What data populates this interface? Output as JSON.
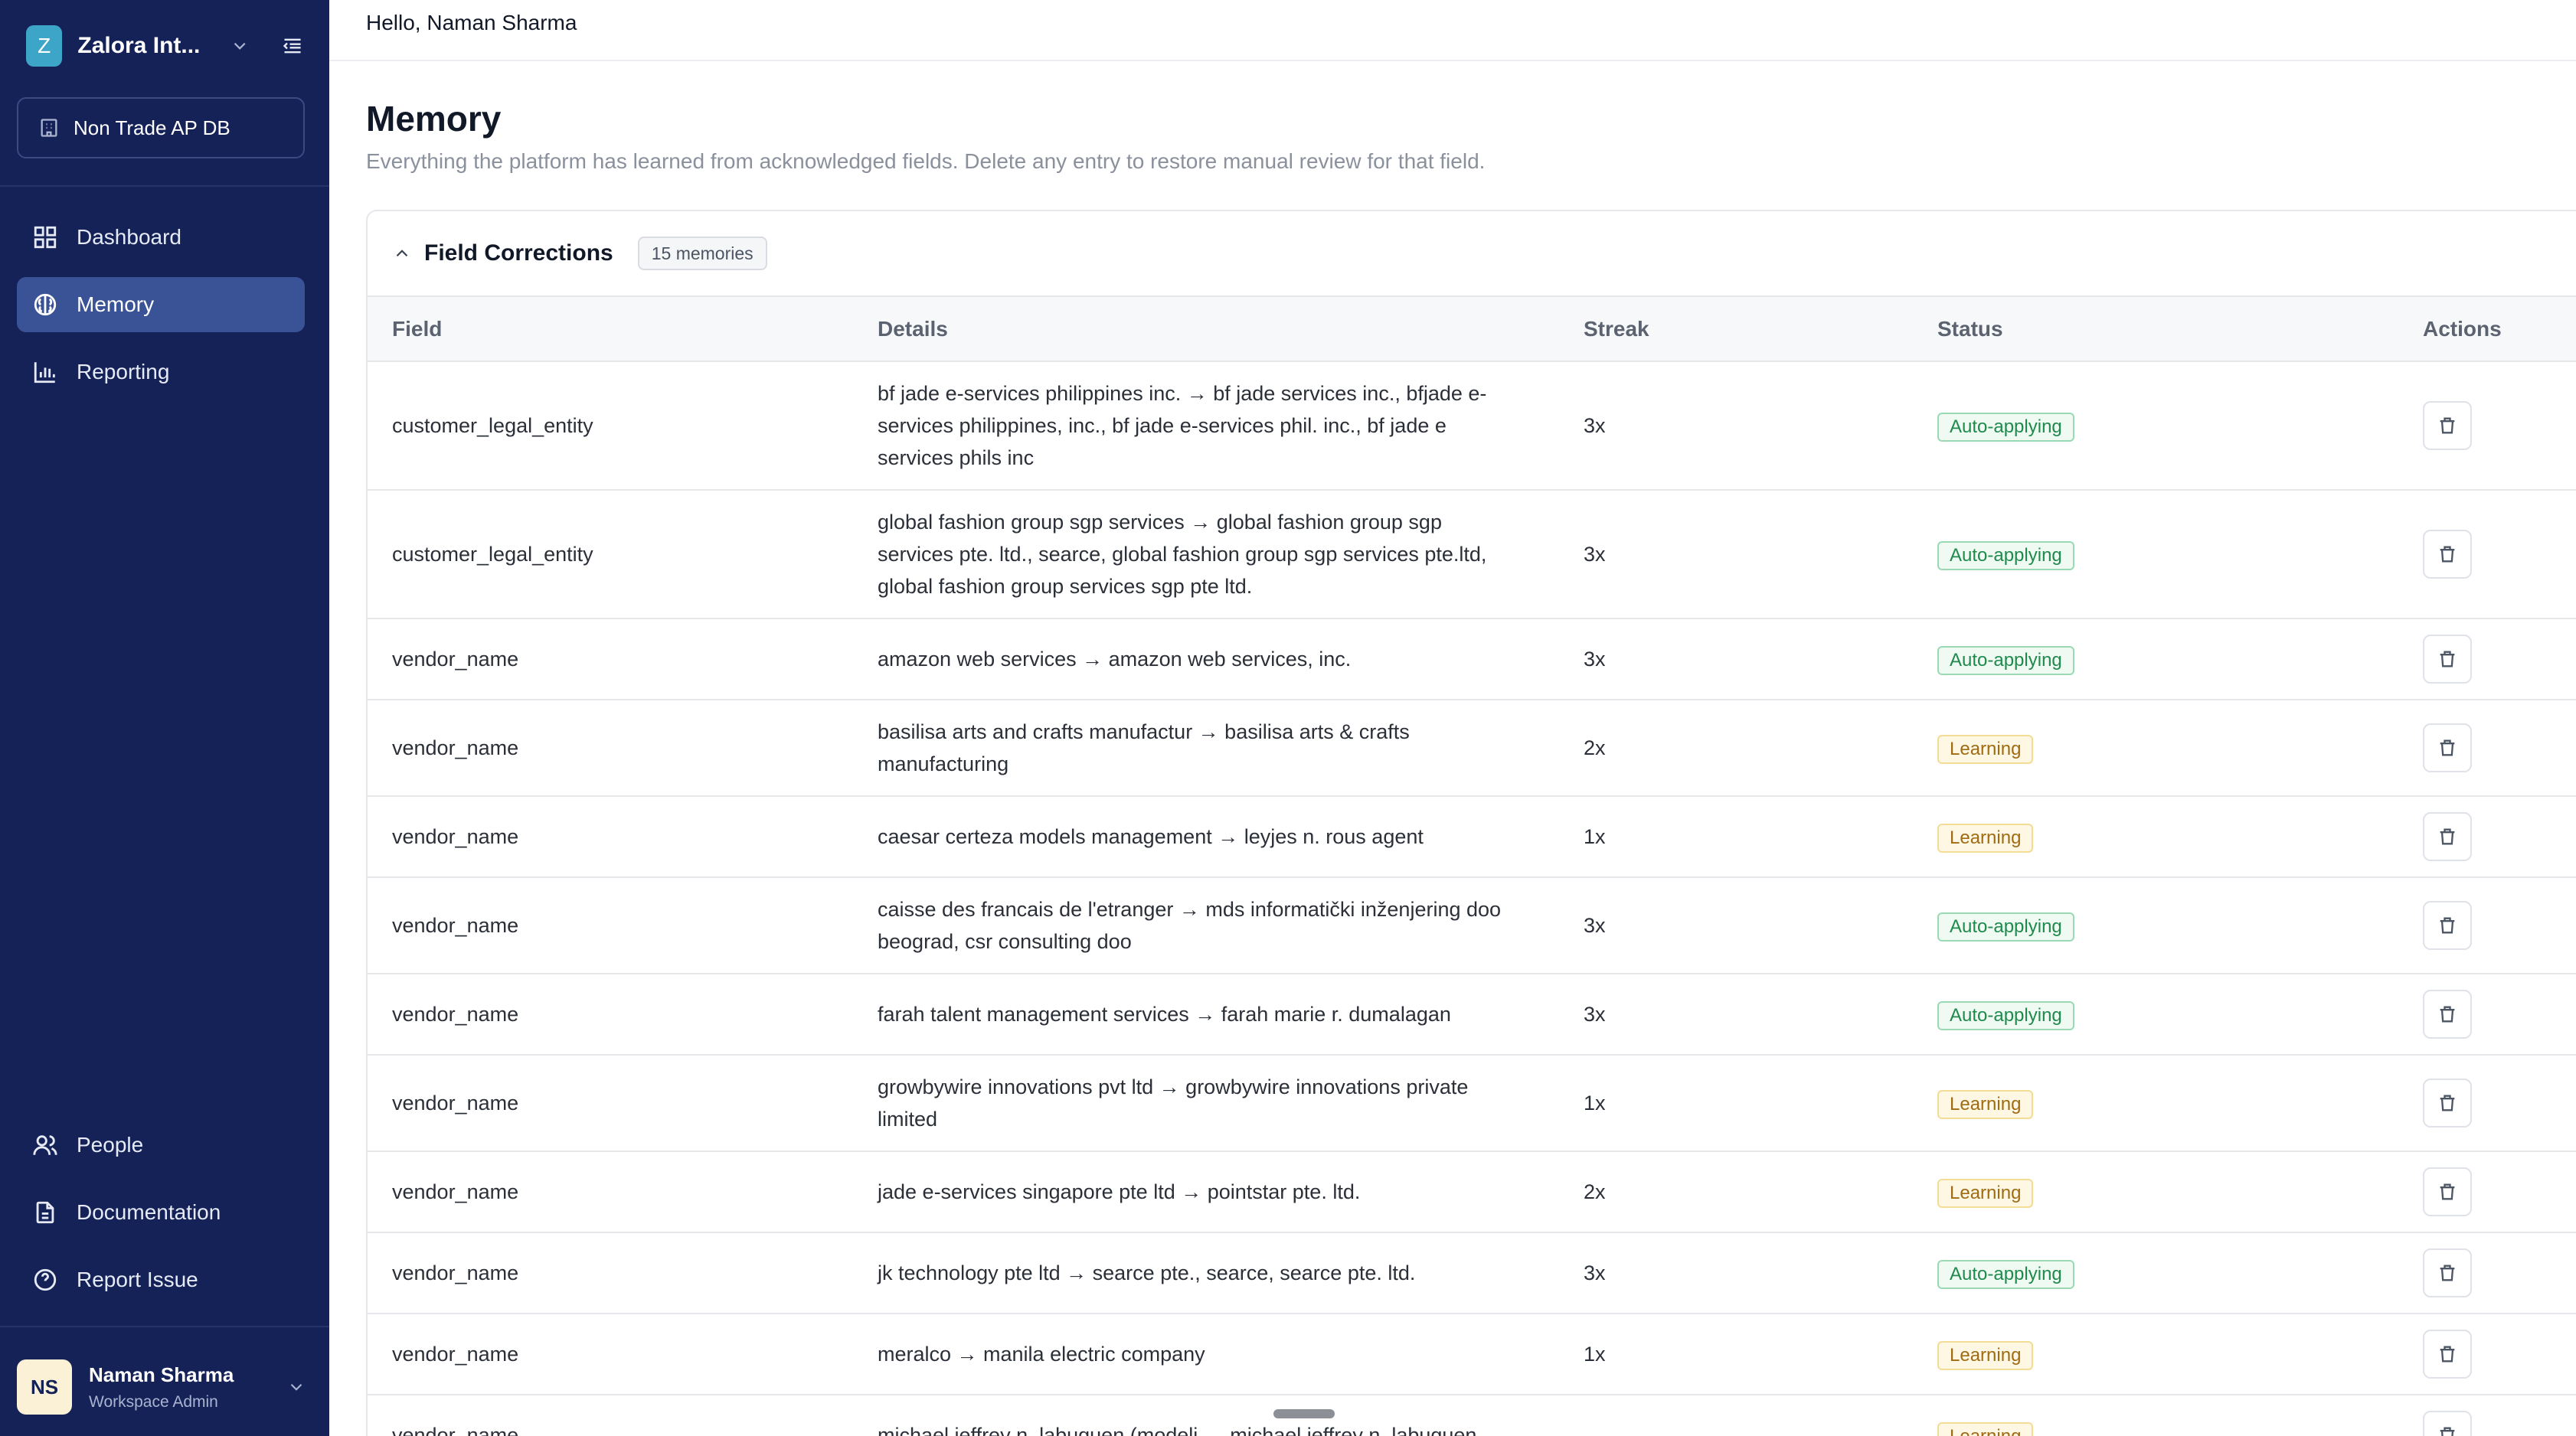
{
  "sidebar": {
    "org": {
      "initial": "Z",
      "name": "Zalora Int..."
    },
    "database": "Non Trade AP DB",
    "nav_top": [
      {
        "label": "Dashboard",
        "icon": "grid-icon"
      },
      {
        "label": "Memory",
        "icon": "brain-icon",
        "active": true
      },
      {
        "label": "Reporting",
        "icon": "bar-chart-icon"
      }
    ],
    "nav_bottom": [
      {
        "label": "People",
        "icon": "people-icon"
      },
      {
        "label": "Documentation",
        "icon": "document-icon"
      },
      {
        "label": "Report Issue",
        "icon": "help-circle-icon"
      }
    ],
    "user": {
      "initials": "NS",
      "name": "Naman Sharma",
      "role": "Workspace Admin"
    }
  },
  "header": {
    "greeting": "Hello, Naman Sharma"
  },
  "page": {
    "title": "Memory",
    "subtitle": "Everything the platform has learned from acknowledged fields. Delete any entry to restore manual review for that field."
  },
  "card": {
    "title": "Field Corrections",
    "count": "15 memories",
    "columns": [
      "Field",
      "Details",
      "Streak",
      "Status",
      "Actions"
    ],
    "rows": [
      {
        "field": "customer_legal_entity",
        "details": "bf jade e-services philippines inc. → bf jade services inc., bfjade e-services philippines, inc., bf jade e-services phil. inc., bf jade e services phils inc",
        "streak": "3x",
        "status": "Auto-applying"
      },
      {
        "field": "customer_legal_entity",
        "details": "global fashion group sgp services → global fashion group sgp services pte. ltd., searce, global fashion group sgp services pte.ltd, global fashion group services sgp pte ltd.",
        "streak": "3x",
        "status": "Auto-applying"
      },
      {
        "field": "vendor_name",
        "details": "amazon web services → amazon web services, inc.",
        "streak": "3x",
        "status": "Auto-applying"
      },
      {
        "field": "vendor_name",
        "details": "basilisa arts and crafts manufactur → basilisa arts & crafts manufacturing",
        "streak": "2x",
        "status": "Learning"
      },
      {
        "field": "vendor_name",
        "details": "caesar certeza models management → leyjes n. rous agent",
        "streak": "1x",
        "status": "Learning"
      },
      {
        "field": "vendor_name",
        "details": "caisse des francais de l'etranger → mds informatički inženjering doo beograd, csr consulting doo",
        "streak": "3x",
        "status": "Auto-applying"
      },
      {
        "field": "vendor_name",
        "details": "farah talent management services → farah marie r. dumalagan",
        "streak": "3x",
        "status": "Auto-applying"
      },
      {
        "field": "vendor_name",
        "details": "growbywire innovations pvt ltd → growbywire innovations private limited",
        "streak": "1x",
        "status": "Learning"
      },
      {
        "field": "vendor_name",
        "details": "jade e-services singapore pte ltd → pointstar pte. ltd.",
        "streak": "2x",
        "status": "Learning"
      },
      {
        "field": "vendor_name",
        "details": "jk technology pte ltd → searce pte., searce, searce pte. ltd.",
        "streak": "3x",
        "status": "Auto-applying"
      },
      {
        "field": "vendor_name",
        "details": "meralco → manila electric company",
        "streak": "1x",
        "status": "Learning"
      },
      {
        "field": "vendor_name",
        "details": "michael jeffrey n. labuguen (modeli → michael jeffrey n. labuguen",
        "streak": "",
        "status": "Learning"
      }
    ]
  },
  "colors": {
    "sidebar_bg": "#152258",
    "active_nav": "#3a5296",
    "auto_applying": "#1f8a4c",
    "learning": "#a06b12"
  }
}
